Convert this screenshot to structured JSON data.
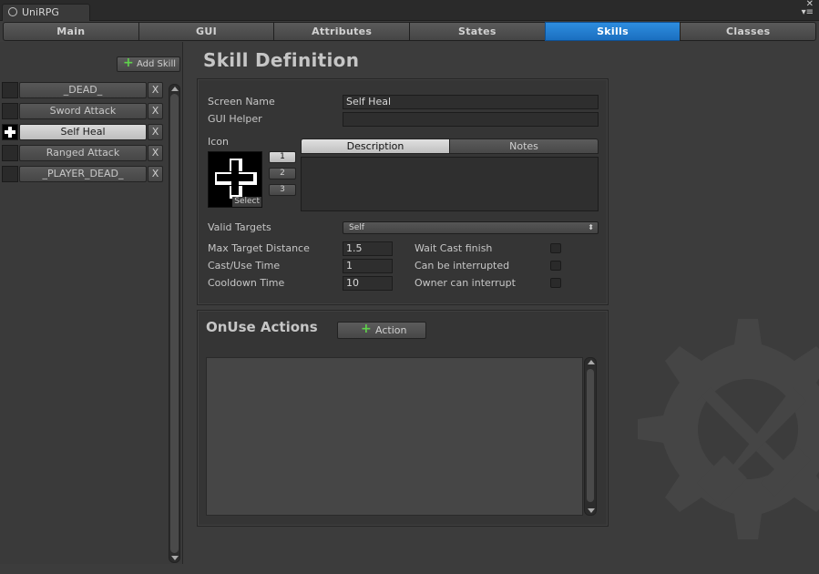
{
  "window": {
    "tab_title": "UniRPG",
    "close_glyph": "✕",
    "menu_glyph": "▾≡"
  },
  "main_tabs": [
    {
      "label": "Main",
      "active": false
    },
    {
      "label": "GUI",
      "active": false
    },
    {
      "label": "Attributes",
      "active": false
    },
    {
      "label": "States",
      "active": false
    },
    {
      "label": "Skills",
      "active": true
    },
    {
      "label": "Classes",
      "active": false
    }
  ],
  "sidebar": {
    "add_skill_label": "Add Skill",
    "delete_glyph": "X",
    "skills": [
      {
        "name": "_DEAD_",
        "selected": false
      },
      {
        "name": "Sword Attack",
        "selected": false
      },
      {
        "name": "Self Heal",
        "selected": true
      },
      {
        "name": "Ranged Attack",
        "selected": false
      },
      {
        "name": "_PLAYER_DEAD_",
        "selected": false
      }
    ]
  },
  "definition": {
    "title": "Skill Definition",
    "screen_name_label": "Screen Name",
    "screen_name_value": "Self Heal",
    "gui_helper_label": "GUI Helper",
    "gui_helper_value": "",
    "icon_label": "Icon",
    "icon_select_label": "Select",
    "icon_slots": [
      "1",
      "2",
      "3"
    ],
    "active_icon_slot": "1",
    "subtabs": {
      "description": "Description",
      "notes": "Notes",
      "active": "Description"
    },
    "description_text": "",
    "valid_targets_label": "Valid Targets",
    "valid_targets_value": "Self",
    "dropdown_caret": "⬍",
    "max_target_distance_label": "Max Target Distance",
    "max_target_distance_value": "1.5",
    "cast_use_time_label": "Cast/Use Time",
    "cast_use_time_value": "1",
    "cooldown_time_label": "Cooldown Time",
    "cooldown_time_value": "10",
    "wait_cast_finish_label": "Wait Cast finish",
    "wait_cast_finish": false,
    "can_be_interrupted_label": "Can be interrupted",
    "can_be_interrupted": false,
    "owner_can_interrupt_label": "Owner can interrupt",
    "owner_can_interrupt": false
  },
  "onuse": {
    "title": "OnUse Actions",
    "action_button_label": "Action",
    "actions": []
  },
  "colors": {
    "accent": "#1a7fd6",
    "plus": "#5fd24b",
    "background": "#3c3c3c"
  },
  "icons": {
    "skill_icon": "plus-cross",
    "add": "plus-icon",
    "watermark": "gear-tools-icon"
  }
}
